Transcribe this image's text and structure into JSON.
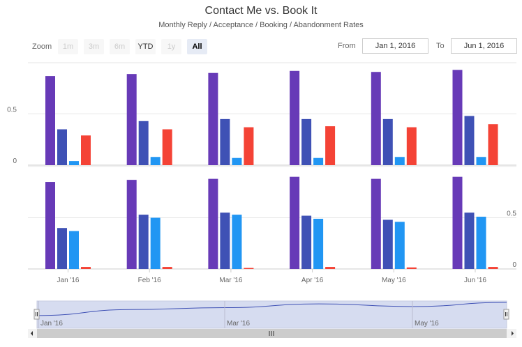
{
  "title": "Contact Me vs. Book It",
  "subtitle": "Monthly Reply / Acceptance / Booking / Abandonment Rates",
  "range_selector": {
    "zoom_label": "Zoom",
    "buttons": [
      {
        "label": "1m",
        "state": "disabled"
      },
      {
        "label": "3m",
        "state": "disabled"
      },
      {
        "label": "6m",
        "state": "disabled"
      },
      {
        "label": "YTD",
        "state": "enabled"
      },
      {
        "label": "1y",
        "state": "disabled"
      },
      {
        "label": "All",
        "state": "active"
      }
    ],
    "from_label": "From",
    "from_value": "Jan 1, 2016",
    "to_label": "To",
    "to_value": "Jun 1, 2016"
  },
  "colors": {
    "reply": "#673ab7",
    "acceptance": "#3f51b5",
    "booking": "#2196f3",
    "abandonment": "#f44336",
    "navigator_fill": "#d6dcf0",
    "navigator_line": "#3f51b5"
  },
  "chart_data": [
    {
      "type": "bar",
      "categories": [
        "Jan '16",
        "Feb '16",
        "Mar '16",
        "Apr '16",
        "May '16",
        "Jun '16"
      ],
      "ylim": [
        0,
        1
      ],
      "yticks": [
        {
          "value": 0,
          "label": "0"
        },
        {
          "value": 0.5,
          "label": "0.5"
        }
      ],
      "series": [
        {
          "color_key": "reply",
          "values": [
            0.87,
            0.89,
            0.9,
            0.92,
            0.91,
            0.93
          ]
        },
        {
          "color_key": "acceptance",
          "values": [
            0.35,
            0.43,
            0.45,
            0.45,
            0.45,
            0.48
          ]
        },
        {
          "color_key": "booking",
          "values": [
            0.04,
            0.08,
            0.07,
            0.07,
            0.08,
            0.08
          ]
        },
        {
          "color_key": "abandonment",
          "values": [
            0.29,
            0.35,
            0.37,
            0.38,
            0.37,
            0.4
          ]
        }
      ]
    },
    {
      "type": "bar",
      "categories": [
        "Jan '16",
        "Feb '16",
        "Mar '16",
        "Apr '16",
        "May '16",
        "Jun '16"
      ],
      "ylim": [
        0,
        1
      ],
      "yticks": [
        {
          "value": 0,
          "label": "0"
        },
        {
          "value": 0.5,
          "label": "0.5"
        }
      ],
      "series": [
        {
          "color_key": "reply",
          "values": [
            0.85,
            0.87,
            0.88,
            0.9,
            0.88,
            0.9
          ]
        },
        {
          "color_key": "acceptance",
          "values": [
            0.4,
            0.53,
            0.55,
            0.52,
            0.48,
            0.55
          ]
        },
        {
          "color_key": "booking",
          "values": [
            0.37,
            0.5,
            0.53,
            0.49,
            0.46,
            0.51
          ]
        },
        {
          "color_key": "abandonment",
          "values": [
            0.02,
            0.02,
            0.01,
            0.02,
            0.015,
            0.02
          ]
        }
      ]
    }
  ],
  "navigator": {
    "labels": [
      "Jan '16",
      "Mar '16",
      "May '16"
    ],
    "line_values": [
      0.3,
      0.62,
      0.72,
      0.92,
      0.78,
      1.0
    ]
  }
}
